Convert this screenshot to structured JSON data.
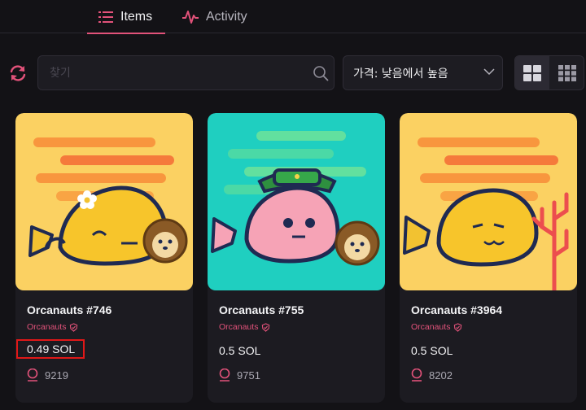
{
  "tabs": [
    {
      "label": "Items",
      "active": true,
      "icon": "list-icon"
    },
    {
      "label": "Activity",
      "active": false,
      "icon": "activity-pulse-icon"
    }
  ],
  "toolbar": {
    "search_placeholder": "찾기",
    "sort_label": "가격: 낮음에서 높음",
    "view_modes": [
      "large-grid",
      "small-grid"
    ],
    "selected_view": "large-grid"
  },
  "colors": {
    "accent": "#e2527a",
    "background": "#131216",
    "card": "#1c1b21",
    "highlight_box": "#e01818"
  },
  "cards": [
    {
      "name": "Orcanauts #746",
      "collection": "Orcanauts",
      "price": "0.49 SOL",
      "likes": "9219",
      "bg": "#fbd162",
      "accessory": "flower",
      "highlighted": true
    },
    {
      "name": "Orcanauts #755",
      "collection": "Orcanauts",
      "price": "0.5 SOL",
      "likes": "9751",
      "bg": "#1fcfc0",
      "accessory": "bucket-hat",
      "highlighted": false
    },
    {
      "name": "Orcanauts #3964",
      "collection": "Orcanauts",
      "price": "0.5 SOL",
      "likes": "8202",
      "bg": "#fbd162",
      "accessory": "coral",
      "highlighted": false
    }
  ]
}
